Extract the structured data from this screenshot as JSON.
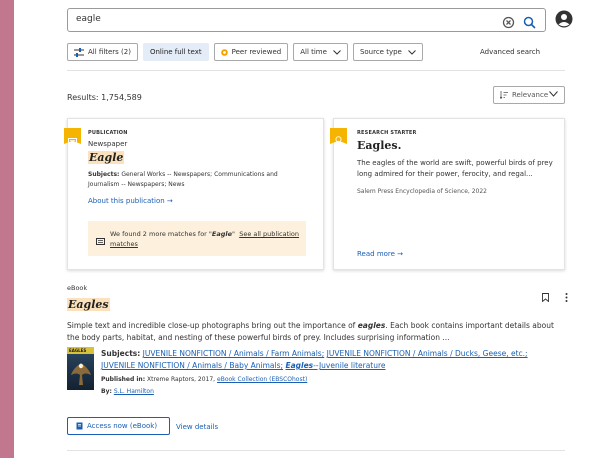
{
  "colors": {
    "accent": "#1a5fb4",
    "highlight": "#fbe2bd",
    "badge": "#f4b400",
    "sidebar": "#c1778d"
  },
  "search": {
    "query": "eagle",
    "clear_icon": "clear-circle-icon",
    "search_icon": "search-icon"
  },
  "header": {
    "account_icon": "account-circle-icon"
  },
  "filters": {
    "all_filters": "All filters (2)",
    "online_full_text": "Online full text",
    "peer_reviewed": "Peer reviewed",
    "all_time": "All time",
    "source_type": "Source type",
    "advanced_search": "Advanced search"
  },
  "results": {
    "count_label": "Results: 1,754,589",
    "sort_label": "Relevance"
  },
  "publication_card": {
    "type": "PUBLICATION",
    "subtype": "Newspaper",
    "title": "Eagle",
    "subjects_label": "Subjects:",
    "subjects": "General Works -- Newspapers; Communications and Journalism -- Newspapers; News",
    "about_link": "About this publication →",
    "more_prefix": "We found 2 more matches for \"",
    "more_term": "Eagle",
    "more_suffix": "\"",
    "see_all": "See all publication matches"
  },
  "research_card": {
    "type": "RESEARCH STARTER",
    "title": "Eagles.",
    "description": "The eagles of the world are swift, powerful birds of prey long admired for their power, ferocity, and regal...",
    "source": "Salem Press Encyclopedia of Science, 2022",
    "read_more": "Read more →"
  },
  "result": {
    "type": "eBook",
    "title": "Eagles",
    "desc_before": "Simple text and incredible close-up photographs bring out the importance of ",
    "desc_term": "eagles",
    "desc_after": ". Each book contains important details about the body parts, habitat, and nesting of these powerful birds of prey. Includes surprising information ...",
    "cover_text": "EAGLES",
    "subjects_label": "Subjects:",
    "subject_1": "JUVENILE NONFICTION / Animals / Farm Animals;",
    "subject_2": "JUVENILE NONFICTION / Animals / Ducks, Geese, etc.;",
    "subject_3": "JUVENILE NONFICTION / Animals / Baby Animals;",
    "subject_4_term": "Eagles",
    "subject_4_rest": "--Juvenile literature",
    "published_label": "Published in:",
    "published_text": "Xtreme Raptors, 2017,",
    "published_link": "eBook Collection (EBSCOhost)",
    "by_label": "By:",
    "by_link": "S.L. Hamilton",
    "access_now": "Access now (eBook)",
    "view_details": "View details"
  }
}
